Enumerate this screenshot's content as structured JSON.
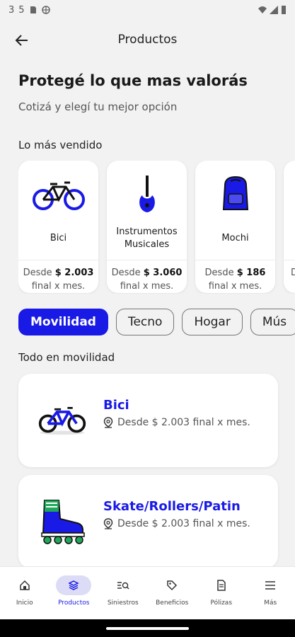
{
  "status_bar": {
    "time": "3",
    "signal": "5"
  },
  "header": {
    "title": "Productos"
  },
  "hero": {
    "title": "Protegé lo que mas valorás",
    "subtitle": "Cotizá y elegí tu mejor opción"
  },
  "best_sellers": {
    "title": "Lo más vendido",
    "items": [
      {
        "name": "Bici",
        "price_prefix": "Desde",
        "price": "$ 2.003",
        "price_suffix": "final x mes."
      },
      {
        "name": "Instrumentos Musicales",
        "price_prefix": "Desde",
        "price": "$ 3.060",
        "price_suffix": "final x mes."
      },
      {
        "name": "Mochi",
        "price_prefix": "Desde",
        "price": "$ 186",
        "price_suffix": "final x mes."
      },
      {
        "name": "",
        "price_prefix": "D",
        "price": "",
        "price_suffix": ""
      }
    ]
  },
  "chips": [
    {
      "label": "Movilidad",
      "active": true
    },
    {
      "label": "Tecno",
      "active": false
    },
    {
      "label": "Hogar",
      "active": false
    },
    {
      "label": "Mús",
      "active": false
    }
  ],
  "category": {
    "title": "Todo en movilidad",
    "items": [
      {
        "name": "Bici",
        "price_text": "Desde $ 2.003 final x mes."
      },
      {
        "name": "Skate/Rollers/Patin",
        "price_text": "Desde $ 2.003 final x mes."
      }
    ]
  },
  "bottom_nav": [
    {
      "label": "Inicio",
      "icon": "home-icon"
    },
    {
      "label": "Productos",
      "icon": "layers-icon",
      "active": true
    },
    {
      "label": "Siniestros",
      "icon": "search-list-icon"
    },
    {
      "label": "Beneficios",
      "icon": "tag-icon"
    },
    {
      "label": "Pólizas",
      "icon": "document-icon"
    },
    {
      "label": "Más",
      "icon": "menu-icon"
    }
  ],
  "colors": {
    "accent": "#1a1ae6",
    "background": "#f2f2f2",
    "card": "#ffffff"
  }
}
